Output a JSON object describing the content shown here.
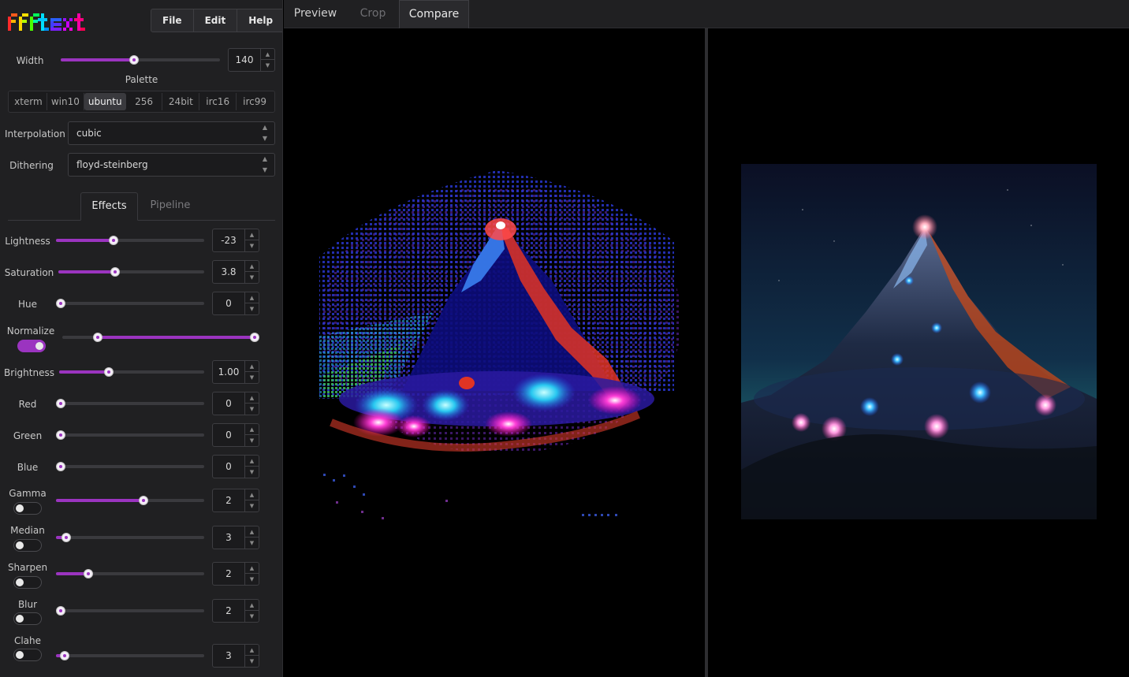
{
  "app": {
    "logo_text": "ffftext"
  },
  "menu": {
    "file": "File",
    "edit": "Edit",
    "help": "Help"
  },
  "width": {
    "label": "Width",
    "value": "140",
    "fraction": 0.46
  },
  "palette": {
    "label": "Palette",
    "options": [
      "xterm",
      "win10",
      "ubuntu",
      "256",
      "24bit",
      "irc16",
      "irc99"
    ],
    "selected": "ubuntu"
  },
  "interpolation": {
    "label": "Interpolation",
    "value": "cubic"
  },
  "dithering": {
    "label": "Dithering",
    "value": "floyd-steinberg"
  },
  "subtabs": {
    "effects": "Effects",
    "pipeline": "Pipeline"
  },
  "effects": {
    "lightness": {
      "label": "Lightness",
      "value": "-23",
      "fraction": 0.39
    },
    "saturation": {
      "label": "Saturation",
      "value": "3.8",
      "fraction": 0.39
    },
    "hue": {
      "label": "Hue",
      "value": "0",
      "fraction": 0.0
    },
    "normalize": {
      "label": "Normalize",
      "enabled": true,
      "range_low": 0.18,
      "range_high": 0.98
    },
    "brightness": {
      "label": "Brightness",
      "value": "1.00",
      "fraction": 0.34
    },
    "red": {
      "label": "Red",
      "value": "0",
      "fraction": 0.0
    },
    "green": {
      "label": "Green",
      "value": "0",
      "fraction": 0.0
    },
    "blue": {
      "label": "Blue",
      "value": "0",
      "fraction": 0.0
    },
    "gamma": {
      "label": "Gamma",
      "value": "2",
      "enabled": false,
      "fraction": 0.59
    },
    "median": {
      "label": "Median",
      "value": "3",
      "enabled": false,
      "fraction": 0.07
    },
    "sharpen": {
      "label": "Sharpen",
      "value": "2",
      "enabled": false,
      "fraction": 0.22
    },
    "blur": {
      "label": "Blur",
      "value": "2",
      "enabled": false,
      "fraction": 0.0
    },
    "clahe": {
      "label": "Clahe",
      "value": "3",
      "enabled": false,
      "fraction": 0.06
    }
  },
  "tabs": {
    "preview": "Preview",
    "crop": "Crop",
    "compare": "Compare",
    "active": "Compare"
  },
  "colors": {
    "accent": "#9b34c0",
    "sidebar_bg": "#202022",
    "canvas_bg": "#000000"
  }
}
